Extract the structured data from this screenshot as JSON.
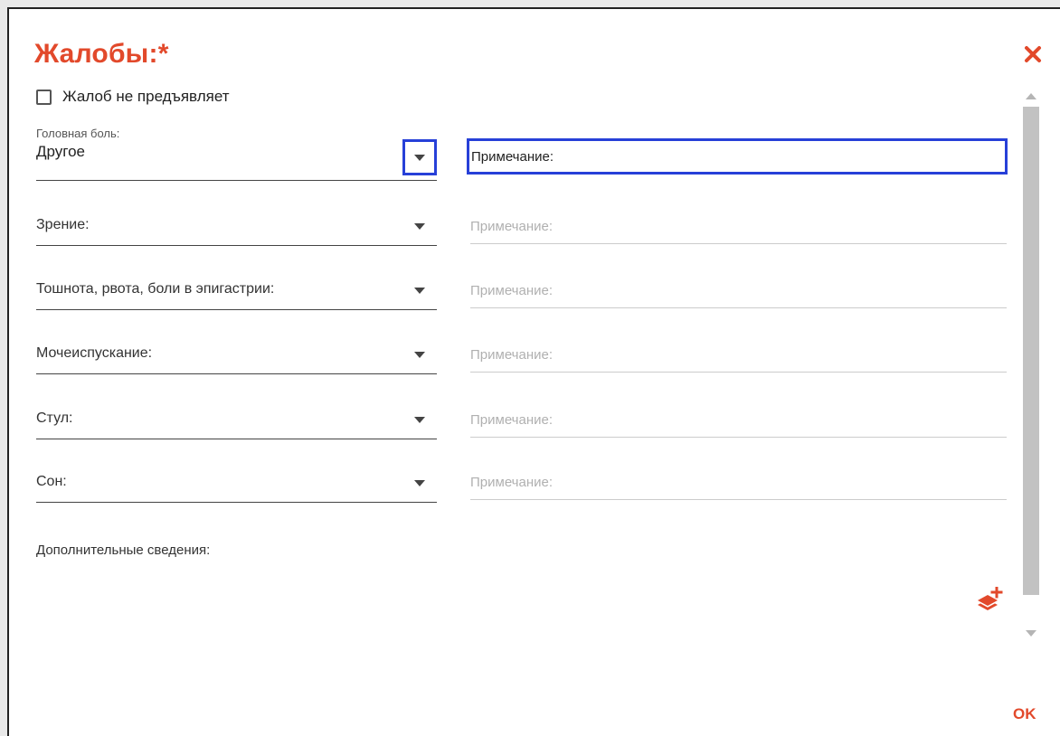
{
  "dialog": {
    "title": "Жалобы:*",
    "no_complaints_label": "Жалоб не предъявляет",
    "headache": {
      "label": "Головная боль:",
      "value": "Другое",
      "note_placeholder": "Примечание:"
    },
    "rows": [
      {
        "label": "Зрение:",
        "note_placeholder": "Примечание:"
      },
      {
        "label": "Тошнота, рвота, боли в эпигастрии:",
        "note_placeholder": "Примечание:"
      },
      {
        "label": "Мочеиспускание:",
        "note_placeholder": "Примечание:"
      },
      {
        "label": "Стул:",
        "note_placeholder": "Примечание:"
      },
      {
        "label": "Сон:",
        "note_placeholder": "Примечание:"
      }
    ],
    "extra_label": "Дополнительные сведения:",
    "ok_label": "OK",
    "icons": {
      "close": "close-icon",
      "add_layer": "add-layer-icon",
      "dropdown": "chevron-down-icon"
    },
    "colors": {
      "accent": "#e2492b",
      "focus": "#2740d8"
    }
  }
}
